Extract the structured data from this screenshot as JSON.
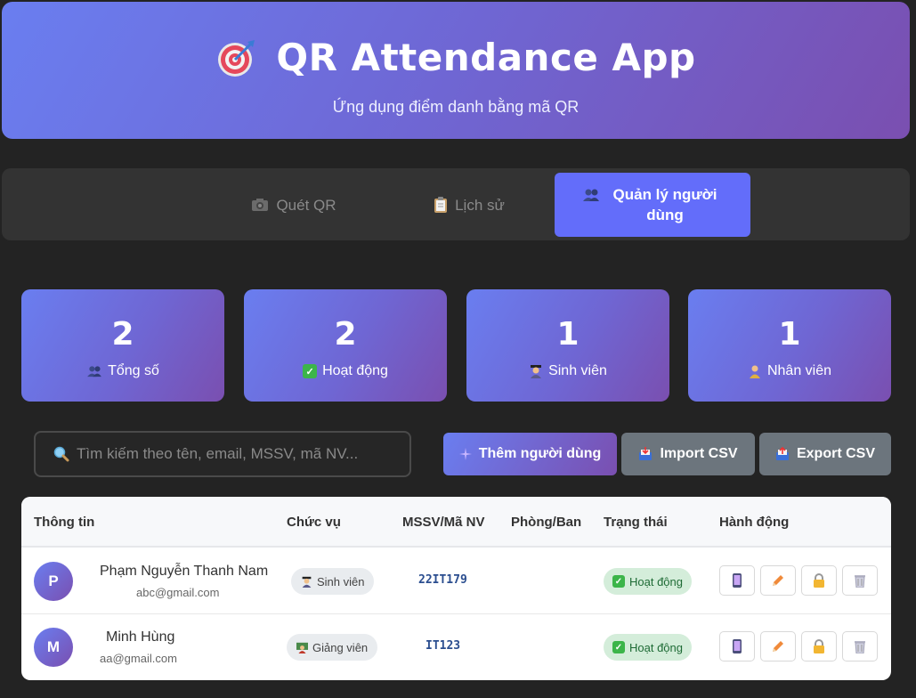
{
  "header": {
    "title": "QR Attendance App",
    "subtitle": "Ứng dụng điểm danh bằng mã QR",
    "icon": "target-icon"
  },
  "tabs": [
    {
      "label": "Quét QR",
      "icon": "camera-icon",
      "active": false
    },
    {
      "label": "Lịch sử",
      "icon": "clipboard-icon",
      "active": false
    },
    {
      "label": "Quản lý người dùng",
      "icon": "users-icon",
      "active": true
    }
  ],
  "stats": [
    {
      "value": "2",
      "label": "Tổng số",
      "icon": "users-icon"
    },
    {
      "value": "2",
      "label": "Hoạt động",
      "icon": "check-icon"
    },
    {
      "value": "1",
      "label": "Sinh viên",
      "icon": "student-icon"
    },
    {
      "value": "1",
      "label": "Nhân viên",
      "icon": "staff-icon"
    }
  ],
  "search": {
    "placeholder": "Tìm kiếm theo tên, email, MSSV, mã NV...",
    "value": ""
  },
  "toolbar": {
    "add_label": "Thêm người dùng",
    "import_label": "Import CSV",
    "export_label": "Export CSV"
  },
  "table": {
    "columns": [
      "Thông tin",
      "Chức vụ",
      "MSSV/Mã NV",
      "Phòng/Ban",
      "Trạng thái",
      "Hành động"
    ],
    "rows": [
      {
        "initial": "P",
        "name": "Phạm Nguyễn Thanh Nam",
        "email": "abc@gmail.com",
        "role": "Sinh viên",
        "code": "22IT179",
        "department": "",
        "status": "Hoạt động"
      },
      {
        "initial": "M",
        "name": "Minh Hùng",
        "email": "aa@gmail.com",
        "role": "Giảng viên",
        "code": "IT123",
        "department": "",
        "status": "Hoạt động"
      }
    ]
  },
  "colors": {
    "accent": "#636dfa",
    "gradient_start": "#6a7ef0",
    "gradient_end": "#7a4fb0",
    "status_bg": "#d4edda",
    "background": "#232323"
  }
}
